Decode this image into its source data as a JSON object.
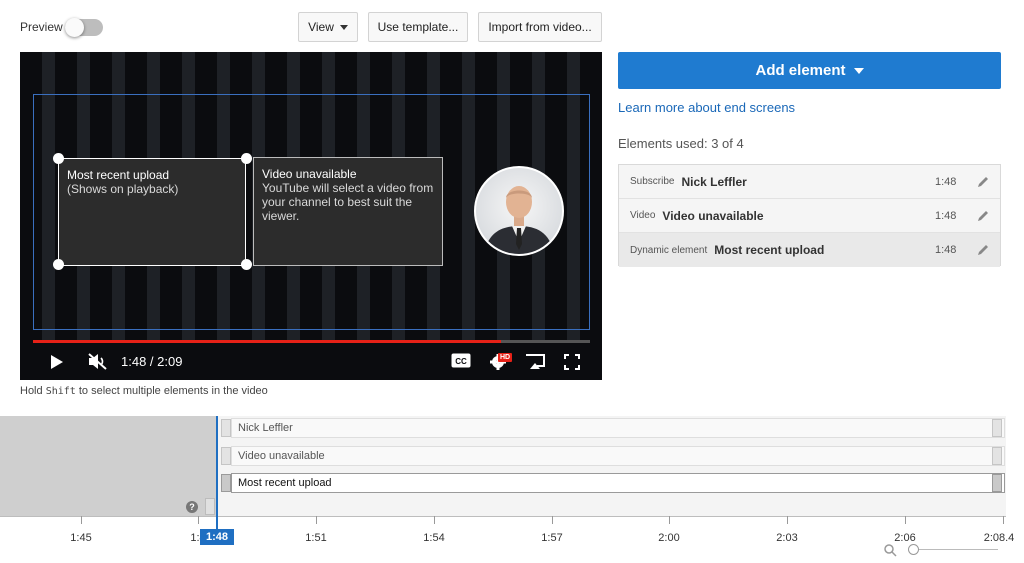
{
  "toolbar": {
    "preview_label": "Preview",
    "view_label": "View",
    "use_template_label": "Use template...",
    "import_label": "Import from video..."
  },
  "player": {
    "elements": {
      "recent_title": "Most recent upload",
      "recent_sub": "(Shows on playback)",
      "unavail_title": "Video unavailable",
      "unavail_sub": "YouTube will select a video from your channel to best suit the viewer."
    },
    "time": "1:48 / 2:09",
    "progress_fraction": 0.84,
    "hd_badge": "HD"
  },
  "hint": {
    "prefix": "Hold",
    "key": "Shift",
    "suffix": "to select multiple elements in the video"
  },
  "panel": {
    "add_element_label": "Add element",
    "learn_more": "Learn more about end screens",
    "elements_used": "Elements used: 3 of 4",
    "rows": [
      {
        "type": "Subscribe",
        "name": "Nick Leffler",
        "time": "1:48"
      },
      {
        "type": "Video",
        "name": "Video unavailable",
        "time": "1:48"
      },
      {
        "type": "Dynamic element",
        "name": "Most recent upload",
        "time": "1:48"
      }
    ]
  },
  "timeline": {
    "tracks": [
      "Nick Leffler",
      "Video unavailable",
      "Most recent upload"
    ],
    "help": "?",
    "ticks": [
      "1:45",
      "1:4",
      "1:51",
      "1:54",
      "1:57",
      "2:00",
      "2:03",
      "2:06",
      "2:08.4"
    ],
    "playhead": "1:48"
  },
  "colors": {
    "accent": "#1f7bd0",
    "progress": "#e62117",
    "link": "#1a68b8"
  }
}
